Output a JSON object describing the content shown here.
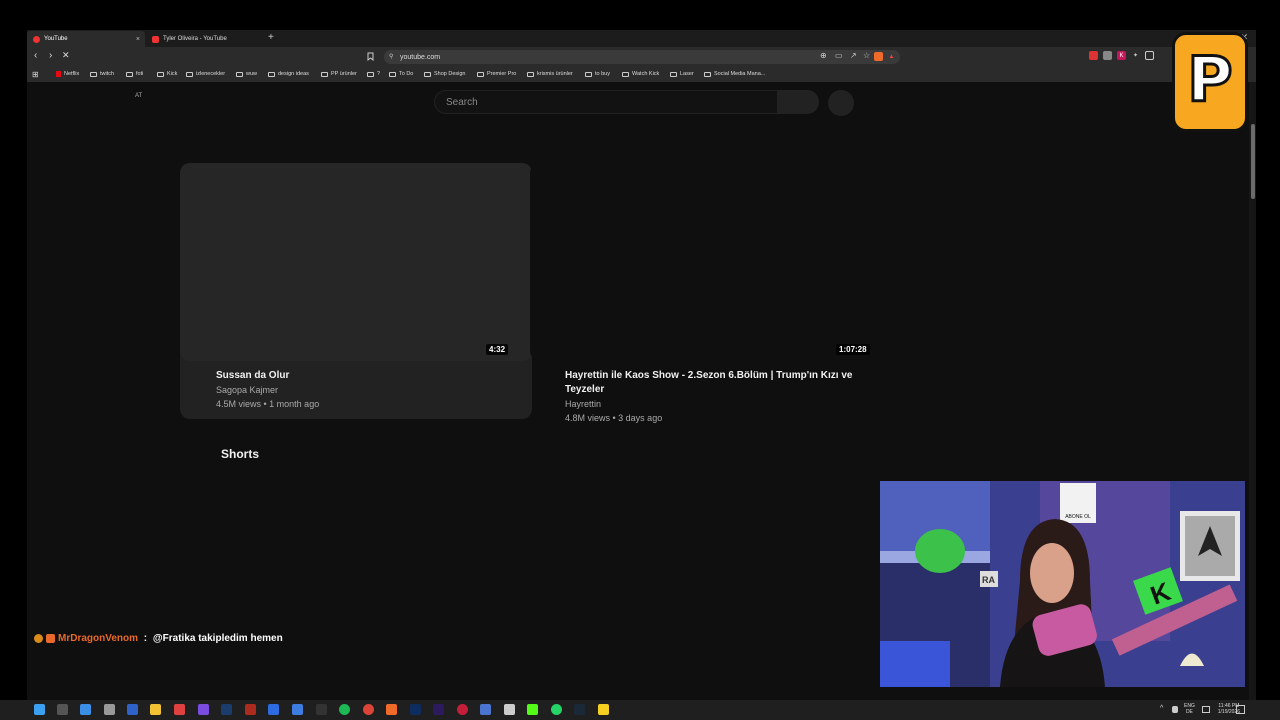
{
  "browser": {
    "tabs": [
      {
        "label": "YouTube",
        "active": true
      },
      {
        "label": "Tyler Oliveira - YouTube",
        "active": false
      }
    ],
    "new_tab": "+",
    "close_tab": "×",
    "window_close": "✕",
    "url": "youtube.com",
    "bookmarks": [
      "Netflix",
      "twitch",
      "foti",
      "Kick",
      "izlenecekler",
      "wuw",
      "design ideas",
      "PP ürünler",
      "?",
      "To Do",
      "Shop Design",
      "Premier Pro",
      "krismis ürünler",
      "to buy",
      "Watch Kick",
      "Laser",
      "Social Media Mana..."
    ]
  },
  "youtube": {
    "country_code": "AT",
    "search_placeholder": "Search",
    "videos": [
      {
        "title": "Sussan da Olur",
        "channel": "Sagopa Kajmer",
        "meta": "4.5M views • 1 month ago",
        "duration": "4:32"
      },
      {
        "title_line1": "Hayrettin ile Kaos Show - 2.Sezon 6.Bölüm | Trump'ın Kızı ve",
        "title_line2": "Teyzeler",
        "channel": "Hayrettin",
        "meta": "4.8M views • 3 days ago",
        "duration": "1:07:28"
      }
    ],
    "shorts_heading": "Shorts"
  },
  "stream_overlay": {
    "chat_user": "MrDragonVenom",
    "chat_separator": " : ",
    "chat_text": "@Fratika takipledim hemen",
    "logo_letter": "P",
    "poster_text": "ABONE OL",
    "sign_letter": "K",
    "side_letters": "RA"
  },
  "taskbar": {
    "lang_line1": "ENG",
    "lang_line2": "DE",
    "time": "11:46 PM",
    "date": "1/19/2026"
  }
}
